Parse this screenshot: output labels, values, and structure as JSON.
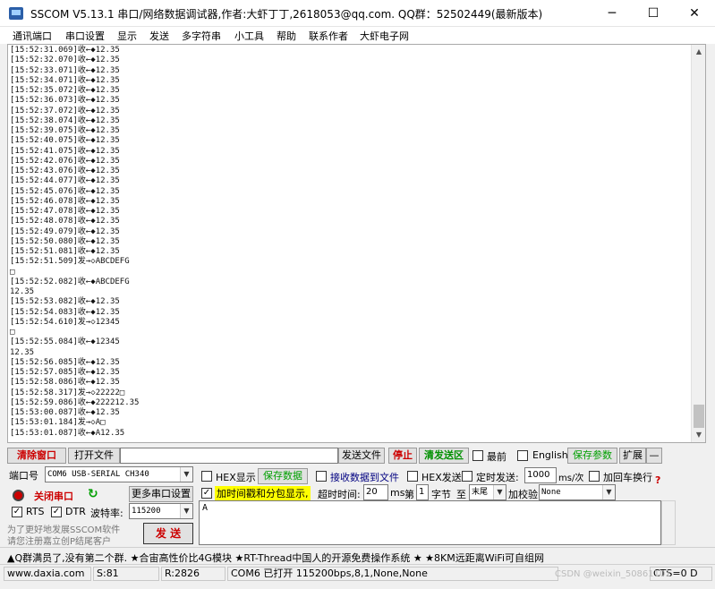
{
  "window": {
    "title": "SSCOM V5.13.1 串口/网络数据调试器,作者:大虾丁丁,2618053@qq.com. QQ群：52502449(最新版本)",
    "min_glyph": "─",
    "max_glyph": "☐",
    "close_glyph": "✕"
  },
  "menu": [
    "通讯端口",
    "串口设置",
    "显示",
    "发送",
    "多字符串",
    "小工具",
    "帮助",
    "联系作者",
    "大虾电子网"
  ],
  "log": [
    "[15:52:31.069]收←◆12.35",
    "[15:52:32.070]收←◆12.35",
    "[15:52:33.071]收←◆12.35",
    "[15:52:34.071]收←◆12.35",
    "[15:52:35.072]收←◆12.35",
    "[15:52:36.073]收←◆12.35",
    "[15:52:37.072]收←◆12.35",
    "[15:52:38.074]收←◆12.35",
    "[15:52:39.075]收←◆12.35",
    "[15:52:40.075]收←◆12.35",
    "[15:52:41.075]收←◆12.35",
    "[15:52:42.076]收←◆12.35",
    "[15:52:43.076]收←◆12.35",
    "[15:52:44.077]收←◆12.35",
    "[15:52:45.076]收←◆12.35",
    "[15:52:46.078]收←◆12.35",
    "[15:52:47.078]收←◆12.35",
    "[15:52:48.078]收←◆12.35",
    "[15:52:49.079]收←◆12.35",
    "[15:52:50.080]收←◆12.35",
    "[15:52:51.081]收←◆12.35",
    "[15:52:51.509]发→◇ABCDEFG",
    "□",
    "[15:52:52.082]收←◆ABCDEFG",
    "12.35",
    "[15:52:53.082]收←◆12.35",
    "[15:52:54.083]收←◆12.35",
    "[15:52:54.610]发→◇12345",
    "□",
    "[15:52:55.084]收←◆12345",
    "12.35",
    "[15:52:56.085]收←◆12.35",
    "[15:52:57.085]收←◆12.35",
    "[15:52:58.086]收←◆12.35",
    "[15:52:58.317]发→◇22222□",
    "[15:52:59.086]收←◆222212.35",
    "[15:53:00.087]收←◆12.35",
    "[15:53:01.184]发→◇A□",
    "[15:53:01.087]收←◆A12.35"
  ],
  "toolbar": {
    "clear": "清除窗口",
    "open_file": "打开文件",
    "file_path": "",
    "send_file": "发送文件",
    "stop": "停止",
    "clear_send": "清发送区",
    "latest": "最前",
    "english": "English",
    "save_params": "保存参数",
    "expand": "扩展",
    "collapse": "—"
  },
  "port": {
    "label": "端口号",
    "value": "COM6 USB-SERIAL CH340",
    "close_btn": "关闭串口",
    "more_settings": "更多串口设置",
    "rts": "RTS",
    "dtr": "DTR",
    "baud_label": "波特率:",
    "baud": "115200",
    "promo": [
      "为了更好地发展SSCOM软件",
      "请您注册嘉立创P结尾客户"
    ]
  },
  "opts": {
    "hex_show": "HEX显示",
    "save_data": "保存数据",
    "recv_to_file": "接收数据到文件",
    "hex_send": "HEX发送",
    "timed_send": "定时发送:",
    "interval": "1000",
    "unit": "ms/次",
    "add_crlf": "加回车换行",
    "help": "?",
    "timestamp": "加时间戳和分包显示,",
    "timeout_label": "超时时间:",
    "timeout": "20",
    "ms": "ms",
    "nth_label": "第",
    "nth": "1",
    "byte_label": "字节",
    "to_label": "至",
    "to_value": "末尾",
    "checksum_label": "加校验",
    "checksum": "None",
    "send_btn": "发 送",
    "send_text": "A"
  },
  "ticker": "▲Q群满员了,没有第二个群. ★合宙高性价比4G模块 ★RT-Thread中国人的开源免费操作系统 ★ ★8KM远距离WiFi可自组网",
  "status": {
    "site": "www.daxia.com",
    "sent": "S:81",
    "recv": "R:2826",
    "port_info": "COM6 已打开  115200bps,8,1,None,None",
    "cts": "CTS=0 D",
    "watermark": "CSDN @weixin_50861101"
  }
}
